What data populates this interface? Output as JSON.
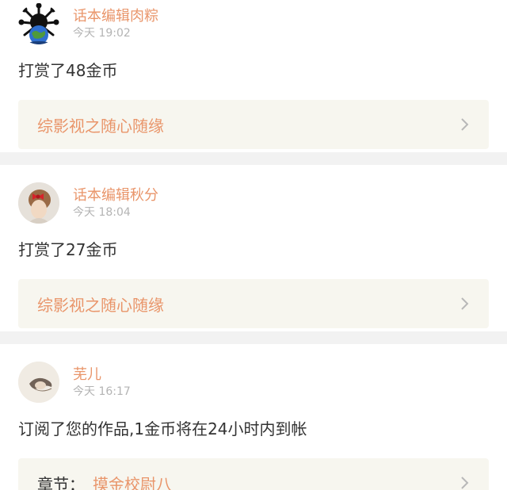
{
  "feed": [
    {
      "user": "话本编辑肉粽",
      "time": "今天 19:02",
      "message": "打赏了48金币",
      "link_label": "",
      "link_text": "综影视之随心随缘",
      "avatar_icon": "earth-virus-avatar"
    },
    {
      "user": "话本编辑秋分",
      "time": "今天 18:04",
      "message": "打赏了27金币",
      "link_label": "",
      "link_text": "综影视之随心随缘",
      "avatar_icon": "girl-red-bow-avatar"
    },
    {
      "user": "芜儿",
      "time": "今天 16:17",
      "message": "订阅了您的作品,1金币将在24小时内到帐",
      "link_label": "章节：",
      "link_text": "摸金校尉八",
      "avatar_icon": "sketch-portrait-avatar"
    }
  ],
  "colors": {
    "accent": "#e9956a",
    "text": "#333333",
    "muted": "#b4b4b4",
    "link_bg": "#f7f6ef",
    "page_bg": "#f2f2f2"
  }
}
